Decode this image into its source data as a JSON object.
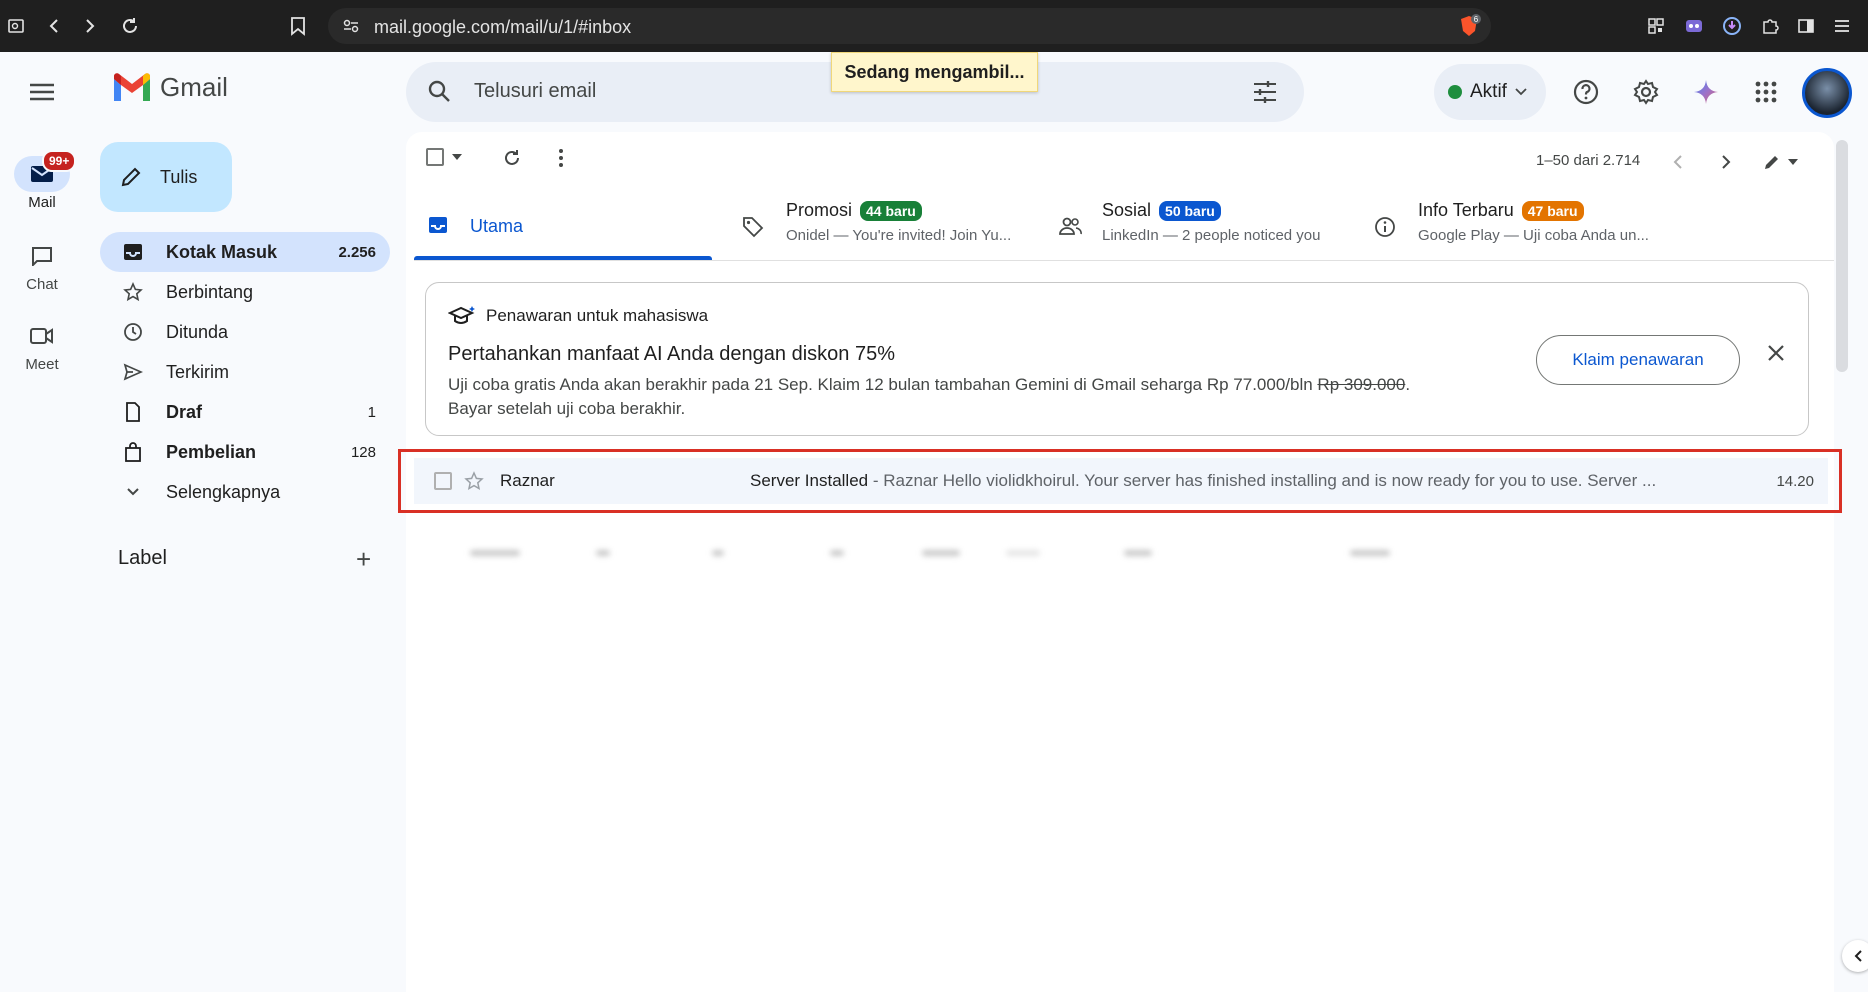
{
  "browser": {
    "url": "mail.google.com/mail/u/1/#inbox",
    "brave_badge": "6"
  },
  "loading_text": "Sedang mengambil...",
  "rail": {
    "mail": {
      "label": "Mail",
      "badge": "99+"
    },
    "chat": {
      "label": "Chat"
    },
    "meet": {
      "label": "Meet"
    }
  },
  "logo_text": "Gmail",
  "compose_label": "Tulis",
  "nav": [
    {
      "label": "Kotak Masuk",
      "count": "2.256"
    },
    {
      "label": "Berbintang",
      "count": ""
    },
    {
      "label": "Ditunda",
      "count": ""
    },
    {
      "label": "Terkirim",
      "count": ""
    },
    {
      "label": "Draf",
      "count": "1"
    },
    {
      "label": "Pembelian",
      "count": "128"
    },
    {
      "label": "Selengkapnya",
      "count": ""
    }
  ],
  "label_section": "Label",
  "search": {
    "placeholder": "Telusuri email"
  },
  "status": {
    "label": "Aktif",
    "color": "#1e8e3e"
  },
  "pager": "1–50 dari 2.714",
  "tabs": [
    {
      "title": "Utama",
      "badge": "",
      "sub": ""
    },
    {
      "title": "Promosi",
      "badge": "44 baru",
      "sub": "Onidel — You're invited! Join Yu...",
      "badge_color": "#188038"
    },
    {
      "title": "Sosial",
      "badge": "50 baru",
      "sub": "LinkedIn — 2 people noticed you",
      "badge_color": "#0b57d0"
    },
    {
      "title": "Info Terbaru",
      "badge": "47 baru",
      "sub": "Google Play — Uji coba Anda un...",
      "badge_color": "#e37400"
    }
  ],
  "promo": {
    "head": "Penawaran untuk mahasiswa",
    "title": "Pertahankan manfaat AI Anda dengan diskon 75%",
    "body_a": "Uji coba gratis Anda akan berakhir pada 21 Sep. Klaim 12 bulan tambahan Gemini di Gmail seharga Rp 77.000/bln ",
    "body_strike": "Rp 309.000",
    "body_b": ".",
    "body_line2": "Bayar setelah uji coba berakhir.",
    "button": "Klaim penawaran"
  },
  "email": {
    "sender": "Raznar",
    "subject": "Server Installed",
    "snippet": " - Raznar Hello violidkhoirul. Your server has finished installing and is now ready for you to use. Server ...",
    "time": "14.20"
  }
}
